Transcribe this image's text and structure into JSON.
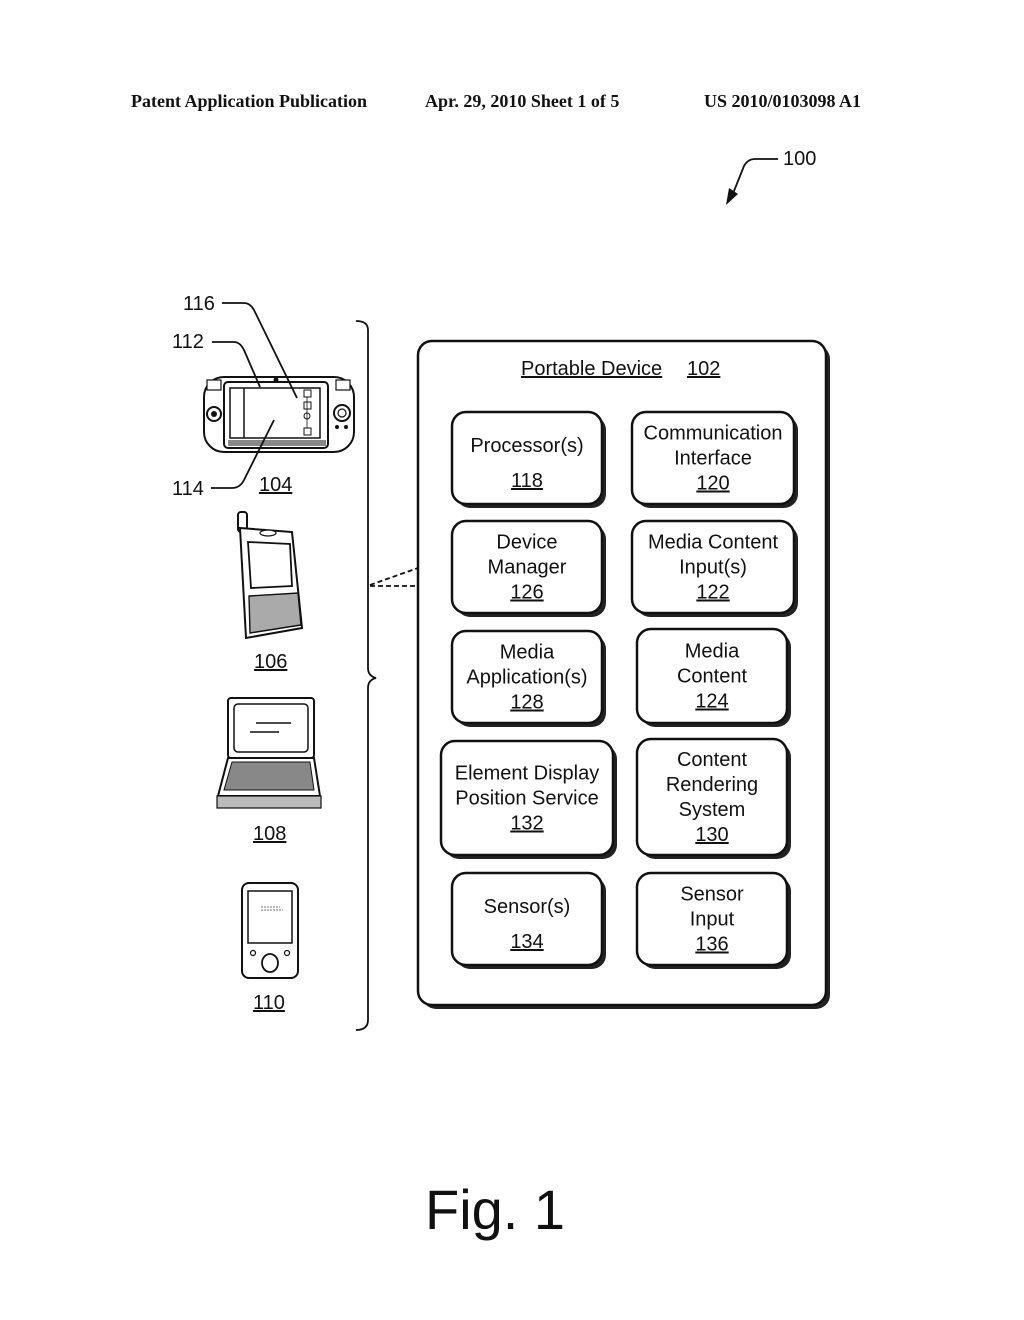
{
  "header": {
    "left": "Patent Application Publication",
    "middle": "Apr. 29, 2010  Sheet 1 of 5",
    "right": "US 2010/0103098 A1"
  },
  "system_ref": "100",
  "devices": {
    "game_device": {
      "ref": "104",
      "callouts": [
        "116",
        "112",
        "114"
      ]
    },
    "phone": {
      "ref": "106"
    },
    "laptop": {
      "ref": "108"
    },
    "media_player": {
      "ref": "110"
    }
  },
  "portable_device": {
    "title": "Portable Device",
    "ref": "102",
    "components": [
      {
        "lines": [
          "Processor(s)"
        ],
        "ref": "118"
      },
      {
        "lines": [
          "Communication",
          "Interface"
        ],
        "ref": "120"
      },
      {
        "lines": [
          "Device",
          "Manager"
        ],
        "ref": "126"
      },
      {
        "lines": [
          "Media Content",
          "Input(s)"
        ],
        "ref": "122"
      },
      {
        "lines": [
          "Media",
          "Application(s)"
        ],
        "ref": "128"
      },
      {
        "lines": [
          "Media",
          "Content"
        ],
        "ref": "124"
      },
      {
        "lines": [
          "Element Display",
          "Position Service"
        ],
        "ref": "132"
      },
      {
        "lines": [
          "Content",
          "Rendering",
          "System"
        ],
        "ref": "130"
      },
      {
        "lines": [
          "Sensor(s)"
        ],
        "ref": "134"
      },
      {
        "lines": [
          "Sensor",
          "Input"
        ],
        "ref": "136"
      }
    ]
  },
  "figure_label": "Fig. 1"
}
